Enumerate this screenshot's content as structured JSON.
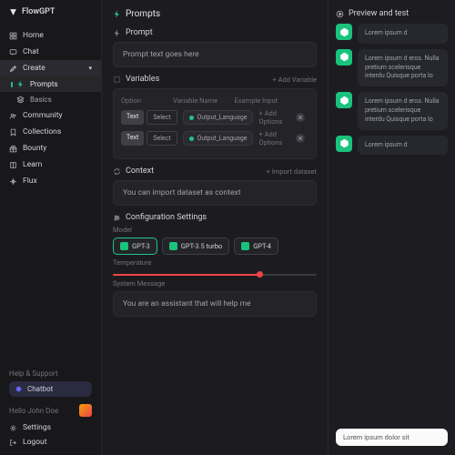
{
  "app": "FlowGPT",
  "sidebar": {
    "items": [
      {
        "label": "Home"
      },
      {
        "label": "Chat"
      },
      {
        "label": "Create"
      },
      {
        "label": "Prompts"
      },
      {
        "label": "Basics"
      },
      {
        "label": "Community"
      },
      {
        "label": "Collections"
      },
      {
        "label": "Bounty"
      },
      {
        "label": "Learn"
      },
      {
        "label": "Flux"
      }
    ],
    "help": "Help & Support",
    "chatbot": "Chatbot",
    "hello": "Hello John Doe",
    "settings": "Settings",
    "logout": "Logout"
  },
  "main": {
    "title": "Prompts",
    "prompt_section": "Prompt",
    "prompt_text": "Prompt text goes here",
    "vars_title": "Variables",
    "add_var": "Add Variable",
    "col_option": "Option",
    "col_var": "Variable Name",
    "col_ex": "Example Input",
    "text": "Text",
    "select": "Select",
    "var_field": "Output_Language",
    "add_options": "Add Options",
    "context_title": "Context",
    "import_dataset": "Import dataset",
    "context_text": "You can import dataset as context",
    "config_title": "Configuration Settings",
    "model_label": "Model",
    "models": [
      "GPT-3",
      "GPT-3.5 turbo",
      "GPT-4"
    ],
    "temperature": "Temperature",
    "sys_label": "System Message",
    "sys_msg": "You are an assistant that will help me"
  },
  "preview": {
    "title": "Preview and test",
    "msgs": [
      "Lorem ipsum d",
      "Lorem ipsum d eros. Nulla pretium scelerisque interdu Quisque porta lo",
      "Lorem ipsum d eros. Nulla pretium scelerisque interdu Quisque porta lo",
      "Lorem ipsum d"
    ],
    "input": "Lorem ipsum dolor sit"
  }
}
